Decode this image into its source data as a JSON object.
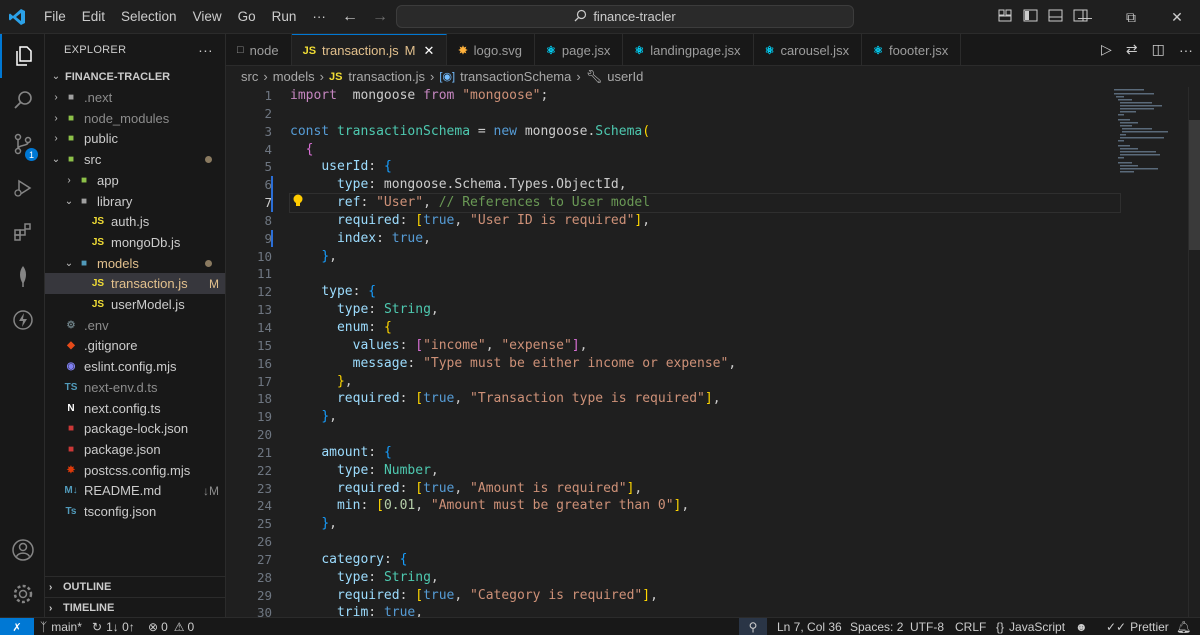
{
  "titlebar": {
    "menu": [
      "File",
      "Edit",
      "Selection",
      "View",
      "Go",
      "Run",
      "···"
    ],
    "search": "finance-tracler"
  },
  "explorer": {
    "title": "EXPLORER",
    "more": "···",
    "project": "FINANCE-TRACLER",
    "items": [
      {
        "label": ".next",
        "level": 1,
        "type": "folder",
        "icon": "■",
        "icon_color": "#a0a0a0",
        "dim": true
      },
      {
        "label": "node_modules",
        "level": 1,
        "type": "folder",
        "icon": "■",
        "icon_color": "#8dc149",
        "dim": true
      },
      {
        "label": "public",
        "level": 1,
        "type": "folder",
        "icon": "■",
        "icon_color": "#8dc149"
      },
      {
        "label": "src",
        "level": 1,
        "type": "folder-open",
        "icon": "■",
        "icon_color": "#8dc149",
        "dot": true
      },
      {
        "label": "app",
        "level": 2,
        "type": "folder",
        "icon": "■",
        "icon_color": "#8dc149"
      },
      {
        "label": "library",
        "level": 2,
        "type": "folder-open",
        "icon": "■",
        "icon_color": "#a0a0a0"
      },
      {
        "label": "auth.js",
        "level": 3,
        "type": "file",
        "icon": "JS",
        "icon_color": "#f1dd35"
      },
      {
        "label": "mongoDb.js",
        "level": 3,
        "type": "file",
        "icon": "JS",
        "icon_color": "#f1dd35"
      },
      {
        "label": "models",
        "level": 2,
        "type": "folder-open",
        "icon": "■",
        "icon_color": "#519aba",
        "accent": "#e2c08d",
        "dot": true
      },
      {
        "label": "transaction.js",
        "level": 3,
        "type": "file",
        "icon": "JS",
        "icon_color": "#f1dd35",
        "status": "M",
        "selected": true,
        "accent": "#e2c08d"
      },
      {
        "label": "userModel.js",
        "level": 3,
        "type": "file",
        "icon": "JS",
        "icon_color": "#f1dd35"
      },
      {
        "label": ".env",
        "level": 1,
        "type": "file",
        "icon": "⚙",
        "icon_color": "#6d8086",
        "dim": true
      },
      {
        "label": ".gitignore",
        "level": 1,
        "type": "file",
        "icon": "◆",
        "icon_color": "#e64a19"
      },
      {
        "label": "eslint.config.mjs",
        "level": 1,
        "type": "file",
        "icon": "◉",
        "icon_color": "#8080f2"
      },
      {
        "label": "next-env.d.ts",
        "level": 1,
        "type": "file",
        "icon": "TS",
        "icon_color": "#519aba",
        "dim": true
      },
      {
        "label": "next.config.ts",
        "level": 1,
        "type": "file",
        "icon": "N",
        "icon_color": "#ffffff"
      },
      {
        "label": "package-lock.json",
        "level": 1,
        "type": "file",
        "icon": "■",
        "icon_color": "#cb3837"
      },
      {
        "label": "package.json",
        "level": 1,
        "type": "file",
        "icon": "■",
        "icon_color": "#cb3837"
      },
      {
        "label": "postcss.config.mjs",
        "level": 1,
        "type": "file",
        "icon": "✸",
        "icon_color": "#dd3a0a"
      },
      {
        "label": "README.md",
        "level": 1,
        "type": "file",
        "icon": "M↓",
        "icon_color": "#519aba",
        "status": "↓M"
      },
      {
        "label": "tsconfig.json",
        "level": 1,
        "type": "file",
        "icon": "Ts",
        "icon_color": "#519aba"
      }
    ],
    "outline": "OUTLINE",
    "timeline": "TIMELINE"
  },
  "tabs": [
    {
      "label": "node",
      "icon": "□",
      "icon_color": "#9d9d9d"
    },
    {
      "label": "transaction.js",
      "icon": "JS",
      "icon_color": "#f1dd35",
      "active": true,
      "modified": "M",
      "close": "✕"
    },
    {
      "label": "logo.svg",
      "icon": "✸",
      "icon_color": "#ffb13b"
    },
    {
      "label": "page.jsx",
      "icon": "⚛",
      "icon_color": "#00d8ff"
    },
    {
      "label": "landingpage.jsx",
      "icon": "⚛",
      "icon_color": "#00d8ff"
    },
    {
      "label": "carousel.jsx",
      "icon": "⚛",
      "icon_color": "#00d8ff"
    },
    {
      "label": "foooter.jsx",
      "icon": "⚛",
      "icon_color": "#00d8ff"
    }
  ],
  "breadcrumb": [
    "src",
    "models",
    "JS",
    "transaction.js",
    "transactionSchema",
    "userId"
  ],
  "editor": {
    "current_line": 7,
    "lines": [
      [
        [
          "kw2",
          "import"
        ],
        [
          "",
          "  mongoose "
        ],
        [
          "kw2",
          "from"
        ],
        [
          "",
          " "
        ],
        [
          "str",
          "\"mongoose\""
        ],
        [
          "",
          ";"
        ]
      ],
      [],
      [
        [
          "kw",
          "const"
        ],
        [
          "",
          " "
        ],
        [
          "ty",
          "transactionSchema"
        ],
        [
          "",
          " = "
        ],
        [
          "kw",
          "new"
        ],
        [
          "",
          " mongoose."
        ],
        [
          "ty",
          "Schema"
        ],
        [
          "b1",
          "("
        ]
      ],
      [
        [
          "",
          "  "
        ],
        [
          "b2",
          "{"
        ]
      ],
      [
        [
          "",
          "    "
        ],
        [
          "prop",
          "userId"
        ],
        [
          "",
          ": "
        ],
        [
          "b3",
          "{"
        ]
      ],
      [
        [
          "",
          "      "
        ],
        [
          "prop",
          "type"
        ],
        [
          "",
          ": mongoose.Schema.Types.ObjectId,"
        ]
      ],
      [
        [
          "",
          "      "
        ],
        [
          "prop",
          "ref"
        ],
        [
          "",
          ": "
        ],
        [
          "str",
          "\"User\""
        ],
        [
          "",
          ", "
        ],
        [
          "cm",
          "// References to User model"
        ]
      ],
      [
        [
          "",
          "      "
        ],
        [
          "prop",
          "required"
        ],
        [
          "",
          ": "
        ],
        [
          "b1",
          "["
        ],
        [
          "kw",
          "true"
        ],
        [
          "",
          ", "
        ],
        [
          "str",
          "\"User ID is required\""
        ],
        [
          "b1",
          "]"
        ],
        [
          "",
          ","
        ]
      ],
      [
        [
          "",
          "      "
        ],
        [
          "prop",
          "index"
        ],
        [
          "",
          ": "
        ],
        [
          "kw",
          "true"
        ],
        [
          "",
          ","
        ]
      ],
      [
        [
          "",
          "    "
        ],
        [
          "b3",
          "}"
        ],
        [
          "",
          ","
        ]
      ],
      [],
      [
        [
          "",
          "    "
        ],
        [
          "prop",
          "type"
        ],
        [
          "",
          ": "
        ],
        [
          "b3",
          "{"
        ]
      ],
      [
        [
          "",
          "      "
        ],
        [
          "prop",
          "type"
        ],
        [
          "",
          ": "
        ],
        [
          "ty",
          "String"
        ],
        [
          "",
          ","
        ]
      ],
      [
        [
          "",
          "      "
        ],
        [
          "prop",
          "enum"
        ],
        [
          "",
          ": "
        ],
        [
          "b1",
          "{"
        ]
      ],
      [
        [
          "",
          "        "
        ],
        [
          "prop",
          "values"
        ],
        [
          "",
          ": "
        ],
        [
          "b2",
          "["
        ],
        [
          "str",
          "\"income\""
        ],
        [
          "",
          ", "
        ],
        [
          "str",
          "\"expense\""
        ],
        [
          "b2",
          "]"
        ],
        [
          "",
          ","
        ]
      ],
      [
        [
          "",
          "        "
        ],
        [
          "prop",
          "message"
        ],
        [
          "",
          ": "
        ],
        [
          "str",
          "\"Type must be either income or expense\""
        ],
        [
          "",
          ","
        ]
      ],
      [
        [
          "",
          "      "
        ],
        [
          "b1",
          "}"
        ],
        [
          "",
          ","
        ]
      ],
      [
        [
          "",
          "      "
        ],
        [
          "prop",
          "required"
        ],
        [
          "",
          ": "
        ],
        [
          "b1",
          "["
        ],
        [
          "kw",
          "true"
        ],
        [
          "",
          ", "
        ],
        [
          "str",
          "\"Transaction type is required\""
        ],
        [
          "b1",
          "]"
        ],
        [
          "",
          ","
        ]
      ],
      [
        [
          "",
          "    "
        ],
        [
          "b3",
          "}"
        ],
        [
          "",
          ","
        ]
      ],
      [],
      [
        [
          "",
          "    "
        ],
        [
          "prop",
          "amount"
        ],
        [
          "",
          ": "
        ],
        [
          "b3",
          "{"
        ]
      ],
      [
        [
          "",
          "      "
        ],
        [
          "prop",
          "type"
        ],
        [
          "",
          ": "
        ],
        [
          "ty",
          "Number"
        ],
        [
          "",
          ","
        ]
      ],
      [
        [
          "",
          "      "
        ],
        [
          "prop",
          "required"
        ],
        [
          "",
          ": "
        ],
        [
          "b1",
          "["
        ],
        [
          "kw",
          "true"
        ],
        [
          "",
          ", "
        ],
        [
          "str",
          "\"Amount is required\""
        ],
        [
          "b1",
          "]"
        ],
        [
          "",
          ","
        ]
      ],
      [
        [
          "",
          "      "
        ],
        [
          "prop",
          "min"
        ],
        [
          "",
          ": "
        ],
        [
          "b1",
          "["
        ],
        [
          "num",
          "0.01"
        ],
        [
          "",
          ", "
        ],
        [
          "str",
          "\"Amount must be greater than 0\""
        ],
        [
          "b1",
          "]"
        ],
        [
          "",
          ","
        ]
      ],
      [
        [
          "",
          "    "
        ],
        [
          "b3",
          "}"
        ],
        [
          "",
          ","
        ]
      ],
      [],
      [
        [
          "",
          "    "
        ],
        [
          "prop",
          "category"
        ],
        [
          "",
          ": "
        ],
        [
          "b3",
          "{"
        ]
      ],
      [
        [
          "",
          "      "
        ],
        [
          "prop",
          "type"
        ],
        [
          "",
          ": "
        ],
        [
          "ty",
          "String"
        ],
        [
          "",
          ","
        ]
      ],
      [
        [
          "",
          "      "
        ],
        [
          "prop",
          "required"
        ],
        [
          "",
          ": "
        ],
        [
          "b1",
          "["
        ],
        [
          "kw",
          "true"
        ],
        [
          "",
          ", "
        ],
        [
          "str",
          "\"Category is required\""
        ],
        [
          "b1",
          "]"
        ],
        [
          "",
          ","
        ]
      ],
      [
        [
          "",
          "      "
        ],
        [
          "prop",
          "trim"
        ],
        [
          "",
          ": "
        ],
        [
          "kw",
          "true"
        ],
        [
          "",
          ","
        ]
      ]
    ]
  },
  "statusbar": {
    "branch": "main*",
    "sync": "1↓ 0↑",
    "errors": "0",
    "warnings": "0",
    "position": "Ln 7, Col 36",
    "spaces": "Spaces: 2",
    "encoding": "UTF-8",
    "eol": "CRLF",
    "language": "JavaScript",
    "prettier": "Prettier"
  }
}
